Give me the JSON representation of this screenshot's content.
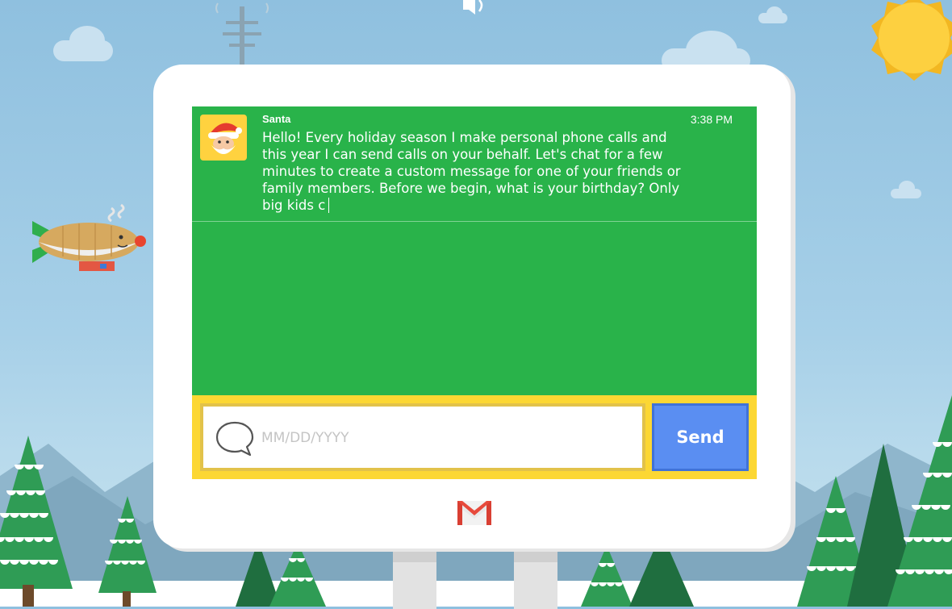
{
  "chat": {
    "sender": "Santa",
    "time": "3:38 PM",
    "message": "Hello! Every holiday season I make personal phone calls and this year I can send calls on your behalf. Let's chat for a few minutes to create a custom message for one of your friends or family members. Before we begin, what is your birthday? Only big kids c"
  },
  "input": {
    "placeholder": "MM/DD/YYYY",
    "value": ""
  },
  "send_label": "Send",
  "colors": {
    "chat_background": "#29b34a",
    "input_bar": "#fcd733",
    "send_button": "#5a8ef2",
    "sky": "#a7d0e8"
  },
  "icons": {
    "avatar": "santa-face-icon",
    "input": "speech-bubble-icon",
    "footer": "gmail-logo-icon",
    "top": "speaker-icon"
  }
}
